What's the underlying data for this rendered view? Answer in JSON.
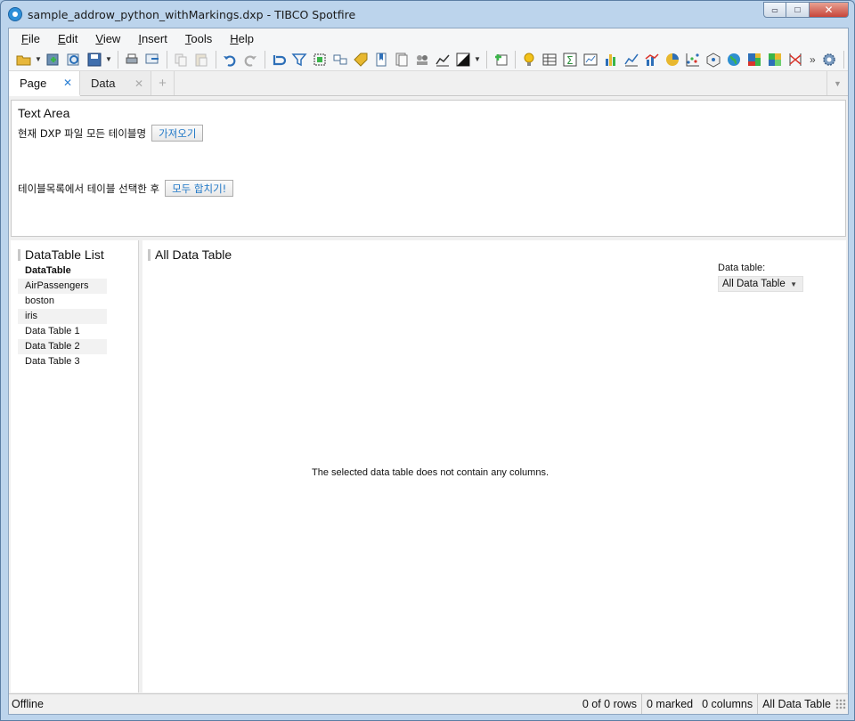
{
  "window": {
    "title": "sample_addrow_python_withMarkings.dxp - TIBCO Spotfire",
    "controls": {
      "minimize": "▭",
      "maximize": "□",
      "close": "✕"
    }
  },
  "menu": [
    {
      "accel": "F",
      "rest": "ile"
    },
    {
      "accel": "E",
      "rest": "dit"
    },
    {
      "accel": "V",
      "rest": "iew"
    },
    {
      "accel": "I",
      "rest": "nsert"
    },
    {
      "accel": "T",
      "rest": "ools"
    },
    {
      "accel": "H",
      "rest": "elp"
    }
  ],
  "toolbar": {
    "icons": [
      "open-icon",
      "insert-data-icon",
      "reload-icon",
      "save-icon",
      "print-icon",
      "export-icon",
      "copy-icon",
      "paste-icon",
      "undo-icon",
      "redo-icon",
      "reset-icon",
      "filter-icon",
      "markings-icon",
      "data-relations-icon",
      "tags-icon",
      "bookmark-icon",
      "lists-icon",
      "details-icon",
      "properties-icon",
      "color-scheme-icon",
      "new-page-icon",
      "recommendations-icon",
      "table-icon",
      "cross-table-icon",
      "graphical-table-icon",
      "bar-chart-icon",
      "line-chart-icon",
      "combination-chart-icon",
      "pie-chart-icon",
      "scatter-plot-icon",
      "3d-scatter-icon",
      "map-chart-icon",
      "treemap-icon",
      "heat-map-icon",
      "parallel-coordinates-icon",
      "tools-icon"
    ],
    "more": "»"
  },
  "tabs": [
    {
      "label": "Page",
      "close": "✕"
    },
    {
      "label": "Data",
      "close": "✕"
    }
  ],
  "tab_add": "+",
  "tab_menu": "▼",
  "text_area": {
    "title": "Text Area",
    "row1_label": "현재 DXP 파일 모든 테이블명",
    "row1_button": "가져오기",
    "row2_label": "테이블목록에서 테이블 선택한 후",
    "row2_button": "모두 합치기!"
  },
  "datatable_list": {
    "title": "DataTable List",
    "items": [
      "DataTable",
      "AirPassengers",
      "boston",
      "iris",
      "Data Table 1",
      "Data Table 2",
      "Data Table 3"
    ]
  },
  "main": {
    "title": "All Data Table",
    "dt_label": "Data table:",
    "dt_selected": "All Data Table",
    "empty_message": "The selected data table does not contain any columns."
  },
  "status": {
    "connection": "Offline",
    "rows": "0 of 0 rows",
    "marked": "0 marked",
    "columns": "0 columns",
    "table": "All Data Table"
  }
}
